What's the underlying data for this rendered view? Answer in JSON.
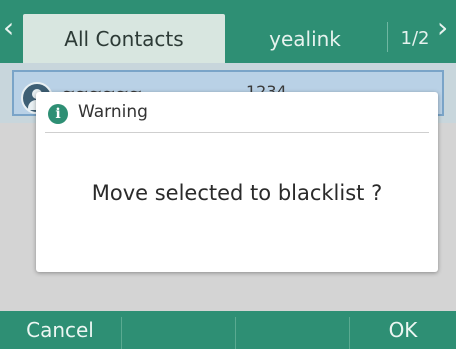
{
  "header": {
    "tabs": [
      {
        "label": "All Contacts",
        "active": true
      },
      {
        "label": "yealink",
        "active": false
      }
    ],
    "page_indicator": "1/2"
  },
  "contact_row": {
    "name": "~~~~~~",
    "number": "1234"
  },
  "dialog": {
    "title": "Warning",
    "message": "Move selected to blacklist ?"
  },
  "softkeys": {
    "key1": "Cancel",
    "key2": "",
    "key3": "",
    "key4": "OK"
  },
  "colors": {
    "accent": "#2e8f74",
    "active_tab": "#d8e6e0",
    "selected_row": "#b9d1e6"
  }
}
